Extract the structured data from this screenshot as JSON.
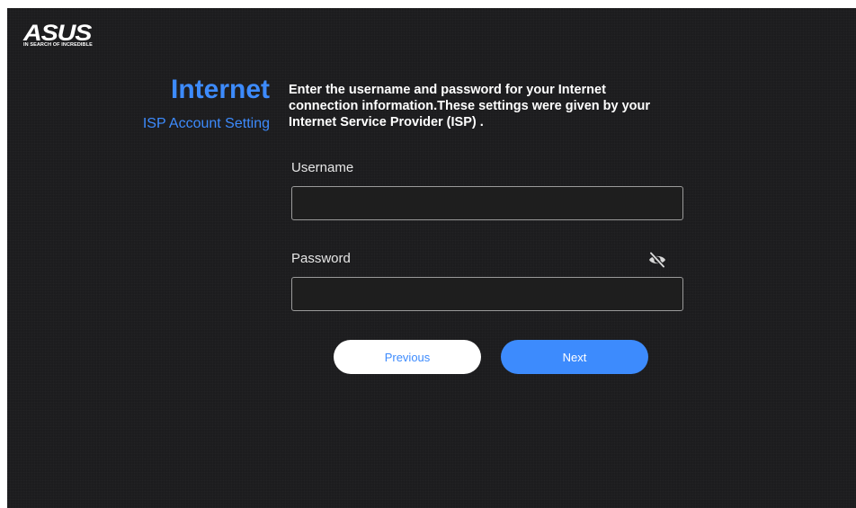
{
  "brand": {
    "logo_text": "ASUS",
    "tagline": "IN SEARCH OF INCREDIBLE"
  },
  "header": {
    "title": "Internet",
    "subtitle": "ISP Account Setting"
  },
  "main": {
    "description": "Enter the username and password for your Internet connection information.These settings were given by your Internet Service Provider (ISP) .",
    "username": {
      "label": "Username",
      "value": "",
      "placeholder": ""
    },
    "password": {
      "label": "Password",
      "value": "",
      "placeholder": "",
      "visibility_icon": "eye-slash-icon"
    }
  },
  "actions": {
    "previous_label": "Previous",
    "next_label": "Next"
  },
  "colors": {
    "background": "#1c1c1e",
    "accent": "#3d8bfd",
    "text": "#ffffff",
    "input_border": "#9a9a9a"
  }
}
